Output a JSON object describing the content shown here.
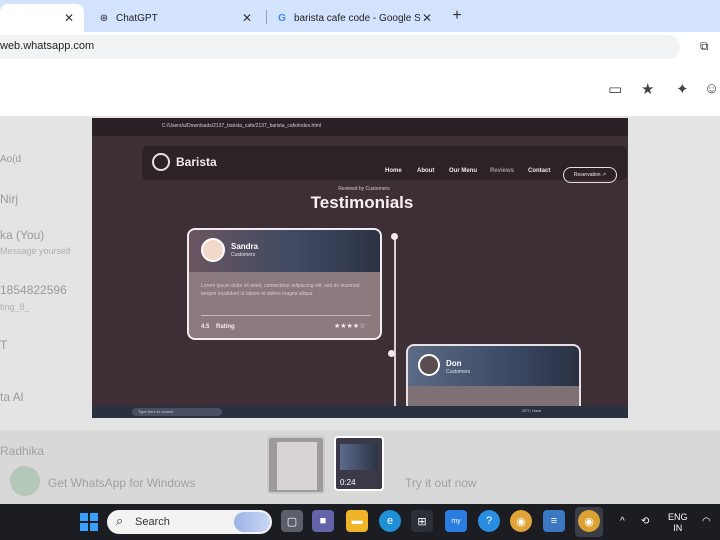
{
  "browser": {
    "tabs": [
      {
        "title": "",
        "icon": "whatsapp-icon",
        "active": true
      },
      {
        "title": "ChatGPT",
        "icon": "chatgpt-icon",
        "active": false
      },
      {
        "title": "barista cafe code - Google Sear",
        "icon": "google-icon",
        "active": false
      }
    ],
    "new_tab_label": "+",
    "url": "web.whatsapp.com"
  },
  "whatsapp": {
    "list_fragments": [
      {
        "text": "Nirj",
        "sub": ""
      },
      {
        "text": "Ao(d",
        "sub": ""
      },
      {
        "text": "ka (You)",
        "sub": "Message yourself"
      },
      {
        "text": "1854822596",
        "sub": "ting_8_"
      },
      {
        "text": "T",
        "sub": ""
      },
      {
        "text": "ta Al",
        "sub": ""
      }
    ],
    "bottom_left_title": "Radhika",
    "bottom_left_text": "Get WhatsApp for Windows",
    "bottom_right_text": "Try it out now"
  },
  "viewer": {
    "path": "C:/Users/u/Downloads/2137_barista_cafe/2137_barista_cafe/index.html",
    "site": {
      "brand": "Barista",
      "menu": [
        "Home",
        "About",
        "Our Menu",
        "Reviews",
        "Contact"
      ],
      "reservation": "Reservation ↗",
      "kicker": "Reviewd by Customers",
      "heading": "Testimonials",
      "card1": {
        "name": "Sandra",
        "role": "Customers",
        "body": "Lorem ipsum dolor sit amet, consectetur adipiscing elit, sed do eiusmod tempor incididunt ut labore et dolore magna aliqua.",
        "rating_value": "4.5",
        "rating_label": "Rating",
        "stars": "★★★★☆"
      },
      "card2": {
        "name": "Don",
        "role": "Customers"
      }
    },
    "inner_taskbar": {
      "search": "Type here to search",
      "weather": "28°C Haze"
    }
  },
  "thumbnails": {
    "video_duration": "0:24"
  },
  "taskbar": {
    "search_label": "Search",
    "lang_line1": "ENG",
    "lang_line2": "IN"
  }
}
